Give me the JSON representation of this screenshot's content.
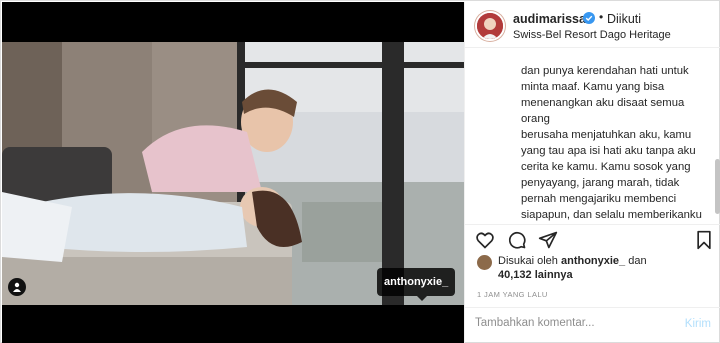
{
  "colors": {
    "accent": "#0095f6",
    "verified": "#3897f0",
    "muted": "#8e8e8e",
    "post_disabled": "#b2dffc"
  },
  "media": {
    "tag_username": "anthonyxie_",
    "user_tag_icon": "person-icon"
  },
  "post": {
    "username": "audimarissa",
    "verified_icon": "verified-badge-icon",
    "separator": "•",
    "follow_state": "Diikuti",
    "location": "Swiss-Bel Resort Dago Heritage",
    "caption": "dan punya kerendahan hati untuk\nminta maaf. Kamu yang bisa\nmenenangkan aku disaat semua orang\nberusaha menjatuhkan aku, kamu\nyang tau apa isi hati aku tanpa aku\ncerita ke kamu. Kamu sosok yang\npenyayang, jarang marah, tidak\npernah mengajariku membenci\nsiapapun, dan selalu memberikanku\nkebaikan-kebaikan yang harus aku\nlakukan dan kita lakukan di dunia.\n."
  },
  "actions": {
    "like_icon": "heart-icon",
    "comment_icon": "comment-icon",
    "share_icon": "paper-plane-icon",
    "save_icon": "bookmark-icon"
  },
  "likes": {
    "prefix": "Disukai oleh",
    "liker": "anthonyxie_",
    "connector": "dan",
    "count": "40,132",
    "count_suffix": "lainnya"
  },
  "timestamp": "1 JAM YANG LALU",
  "comment": {
    "placeholder": "Tambahkan komentar...",
    "post_label": "Kirim"
  }
}
